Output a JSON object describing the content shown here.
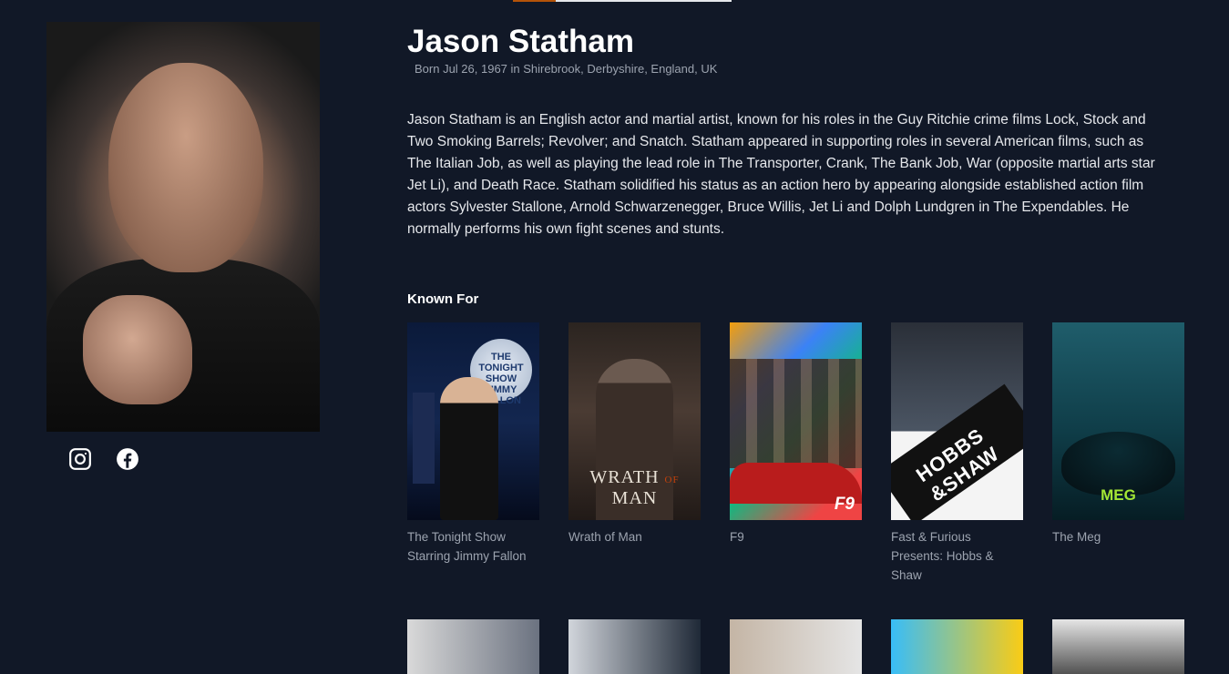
{
  "person": {
    "name": "Jason Statham",
    "born": "Born Jul 26, 1967 in Shirebrook, Derbyshire, England, UK",
    "biography": "Jason Statham is an English actor and martial artist, known for his roles in the Guy Ritchie crime films Lock, Stock and Two Smoking Barrels; Revolver; and Snatch. Statham appeared in supporting roles in several American films, such as The Italian Job, as well as playing the lead role in The Transporter, Crank, The Bank Job, War (opposite martial arts star Jet Li), and Death Race. Statham solidified his status as an action hero by appearing alongside established action film actors Sylvester Stallone, Arnold Schwarzenegger, Bruce Willis, Jet Li and Dolph Lundgren in The Expendables. He normally performs his own fight scenes and stunts."
  },
  "social": {
    "icons": [
      "instagram-icon",
      "facebook-icon"
    ]
  },
  "known_for": {
    "heading": "Known For",
    "items": [
      {
        "title": "The Tonight Show Starring Jimmy Fallon",
        "poster_text": "THE TONIGHT SHOW JIMMY FALLON"
      },
      {
        "title": "Wrath of Man",
        "poster_text": "WRATH of MAN"
      },
      {
        "title": "F9",
        "poster_text": "F9"
      },
      {
        "title": "Fast & Furious Presents: Hobbs & Shaw",
        "poster_text": "HOBBS & SHAW"
      },
      {
        "title": "The Meg",
        "poster_text": "THE MEG"
      }
    ]
  },
  "colors": {
    "background": "#111827",
    "heading": "#ffffff",
    "muted": "#9ca3af",
    "accent": "#b45309"
  }
}
